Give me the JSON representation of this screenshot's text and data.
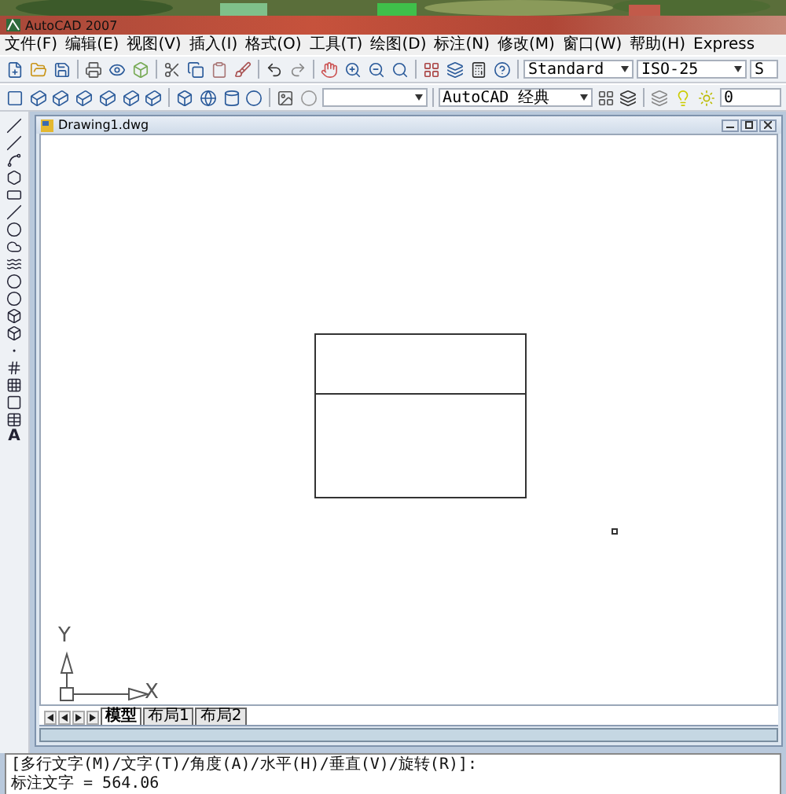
{
  "window": {
    "title": "AutoCAD 2007"
  },
  "menu": [
    "文件(F)",
    "编辑(E)",
    "视图(V)",
    "插入(I)",
    "格式(O)",
    "工具(T)",
    "绘图(D)",
    "标注(N)",
    "修改(M)",
    "窗口(W)",
    "帮助(H)",
    "Express"
  ],
  "toolbar": {
    "text_style": "Standard",
    "dim_style": "ISO-25",
    "table_style": "S",
    "workspace": "AutoCAD 经典",
    "layer": "0"
  },
  "draw_toolbar": {
    "text_tool": "A"
  },
  "document": {
    "title": "Drawing1.dwg",
    "ucs": {
      "x_label": "X",
      "y_label": "Y"
    },
    "layout_tabs": [
      {
        "label": "模型",
        "selected": true
      },
      {
        "label": "布局1",
        "selected": false
      },
      {
        "label": "布局2",
        "selected": false
      }
    ]
  },
  "command_line": [
    "[多行文字(M)/文字(T)/角度(A)/水平(H)/垂直(V)/旋转(R)]:",
    "标注文字 = 564.06"
  ]
}
